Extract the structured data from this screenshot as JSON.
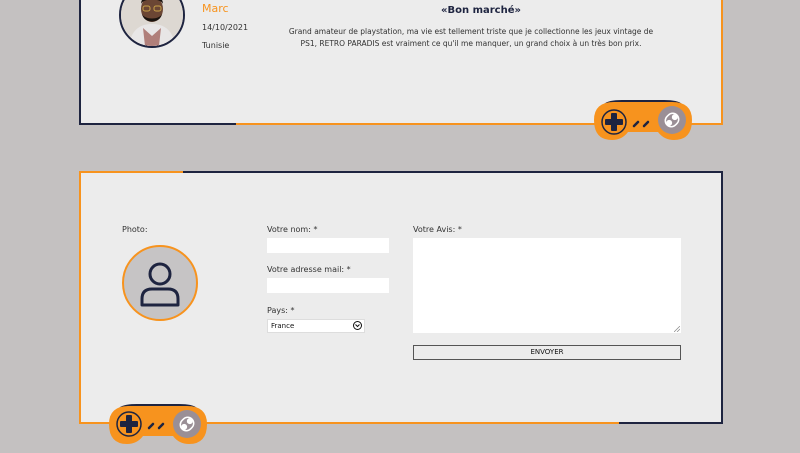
{
  "review": {
    "name": "Marc",
    "date": "14/10/2021",
    "country": "Tunisie",
    "title": "«Bon marché»",
    "text": "Grand amateur de playstation, ma vie est tellement triste que je collectionne les jeux vintage de PS1, RETRO PARADIS est vraiment ce qu'il me manquer, un grand choix à un très bon prix."
  },
  "form": {
    "photo_label": "Photo:",
    "name_label": "Votre nom: *",
    "email_label": "Votre adresse mail: *",
    "country_label": "Pays: *",
    "country_value": "France",
    "review_label": "Votre Avis: *",
    "submit_label": "ENVOYER"
  },
  "colors": {
    "accent": "#f7931e",
    "navy": "#1e2440",
    "card_bg": "#ececec",
    "page_bg": "#c4c1c1"
  },
  "icons": [
    "gamepad-icon",
    "user-icon",
    "chevron-down-icon",
    "resize-grip-icon"
  ]
}
